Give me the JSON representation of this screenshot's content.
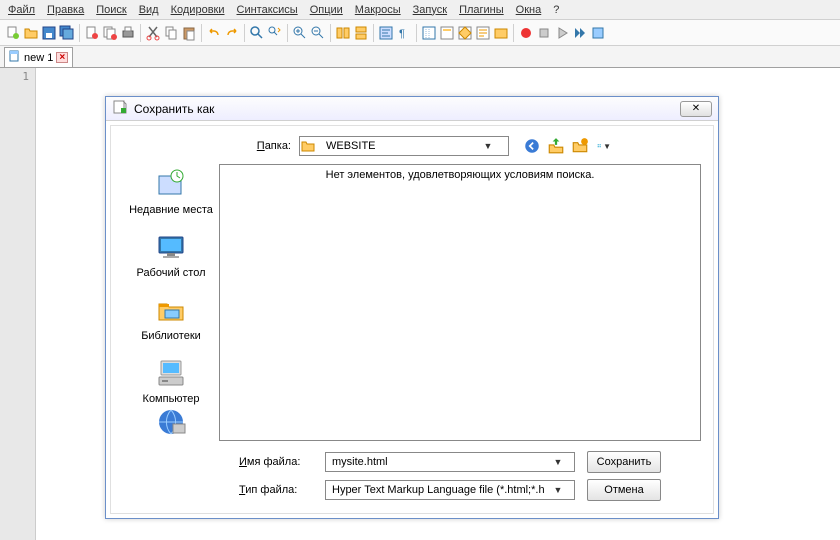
{
  "menus": [
    "Файл",
    "Правка",
    "Поиск",
    "Вид",
    "Кодировки",
    "Синтаксисы",
    "Опции",
    "Макросы",
    "Запуск",
    "Плагины",
    "Окна",
    "?"
  ],
  "tab": {
    "name": "new 1"
  },
  "gutter": {
    "line1": "1"
  },
  "dialog": {
    "title": "Сохранить как",
    "folder_label": "Папка:",
    "folder_value": "WEBSITE",
    "empty_message": "Нет элементов, удовлетворяющих условиям поиска.",
    "sidebar": {
      "recent": "Недавние места",
      "desktop": "Рабочий стол",
      "libraries": "Библиотеки",
      "computer": "Компьютер"
    },
    "filename_label": "Имя файла:",
    "filename_value": "mysite.html",
    "filetype_label": "Тип файла:",
    "filetype_value": "Hyper Text Markup Language file (*.html;*.htm;*",
    "save_btn": "Сохранить",
    "cancel_btn": "Отмена"
  }
}
